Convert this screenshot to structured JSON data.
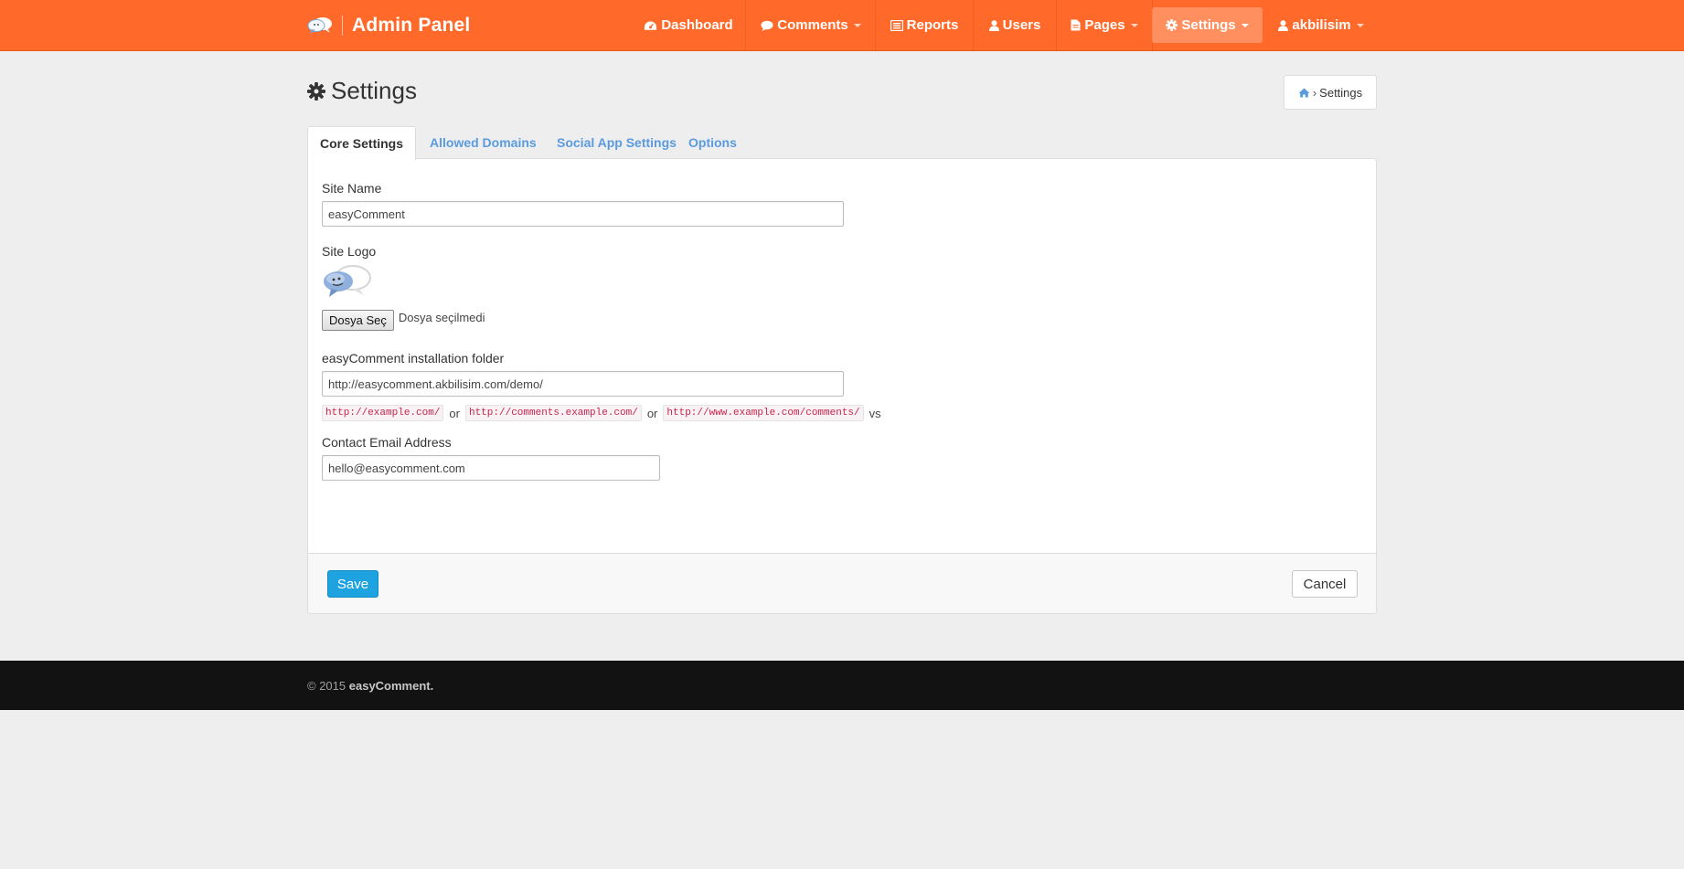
{
  "app": {
    "title": "Admin Panel",
    "accent_color": "#ff6a2a",
    "logo_icon": "speech-bubbles-logo"
  },
  "nav": {
    "items": [
      {
        "label": "Dashboard",
        "icon": "dashboard-icon",
        "dropdown": false,
        "active": false
      },
      {
        "label": "Comments",
        "icon": "comment-icon",
        "dropdown": true,
        "active": false
      },
      {
        "label": "Reports",
        "icon": "list-alt-icon",
        "dropdown": false,
        "active": false
      },
      {
        "label": "Users",
        "icon": "user-icon",
        "dropdown": false,
        "active": false
      },
      {
        "label": "Pages",
        "icon": "file-icon",
        "dropdown": true,
        "active": false
      },
      {
        "label": "Settings",
        "icon": "gear-icon",
        "dropdown": true,
        "active": true
      },
      {
        "label": "akbilisim",
        "icon": "user-icon",
        "dropdown": true,
        "active": false
      }
    ]
  },
  "page": {
    "title": "Settings",
    "title_icon": "gear-icon"
  },
  "breadcrumb": {
    "home_icon": "home-icon",
    "separator": "›",
    "current": "Settings"
  },
  "tabs": [
    {
      "label": "Core Settings",
      "active": true
    },
    {
      "label": "Allowed Domains",
      "active": false
    },
    {
      "label": "Social App Settings",
      "active": false
    },
    {
      "label": "Options",
      "active": false
    }
  ],
  "form": {
    "site_name": {
      "label": "Site Name",
      "value": "easyComment"
    },
    "site_logo": {
      "label": "Site Logo",
      "choose_button": "Dosya Seç",
      "no_file_text": "Dosya seçilmedi"
    },
    "install_folder": {
      "label": "easyComment installation folder",
      "value": "http://easycomment.akbilisim.com/demo/",
      "examples": [
        "http://example.com/",
        "http://comments.example.com/",
        "http://www.example.com/comments/"
      ],
      "joiner": "or",
      "suffix": "vs"
    },
    "contact_email": {
      "label": "Contact Email Address",
      "value": "hello@easycomment.com"
    }
  },
  "actions": {
    "save_label": "Save",
    "cancel_label": "Cancel",
    "save_color": "#1ea3e0"
  },
  "footer": {
    "copyright": "© 2015",
    "brand": "easyComment."
  }
}
